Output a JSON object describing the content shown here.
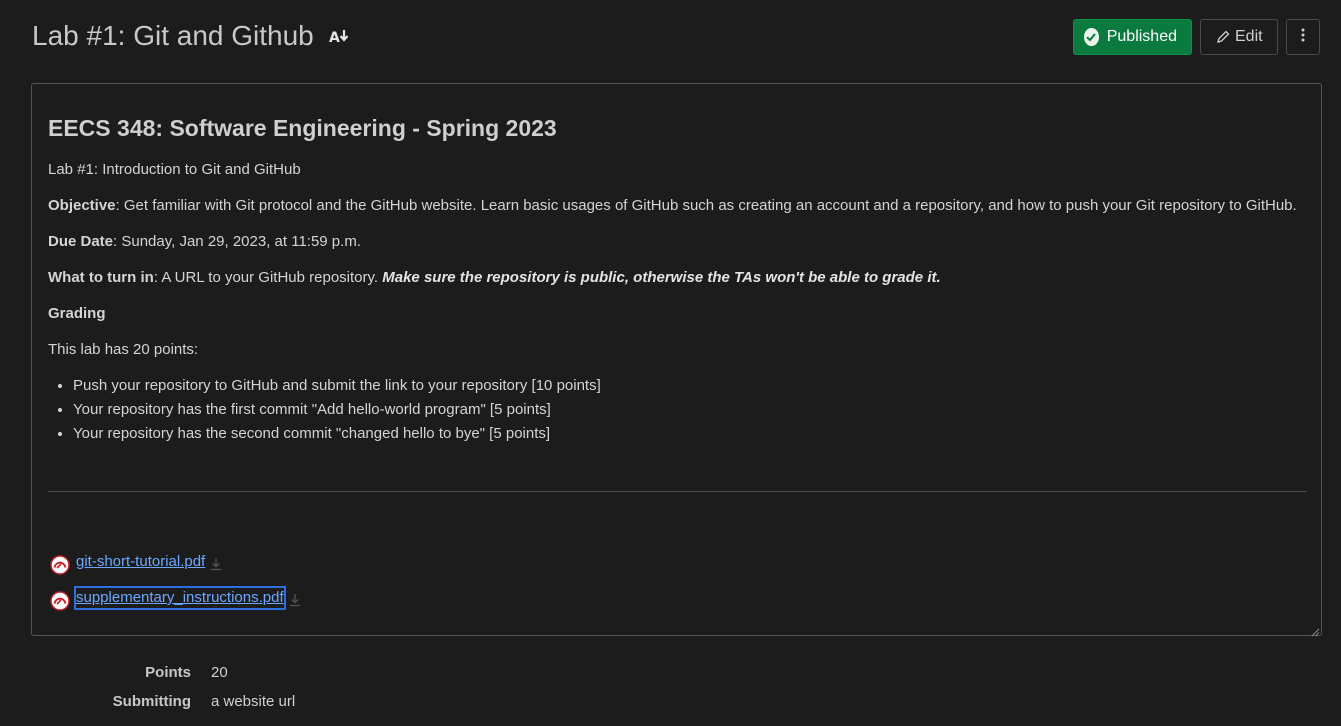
{
  "header": {
    "title": "Lab #1: Git and Github",
    "title_icon": "sort-download-icon",
    "published_label": "Published",
    "edit_label": "Edit",
    "more_icon": "kebab-menu-icon"
  },
  "content": {
    "heading": "EECS 348: Software Engineering - Spring 2023",
    "subtitle": "Lab #1: Introduction to Git and GitHub",
    "objective_label": "Objective",
    "objective_text": ": Get familiar with Git protocol and the GitHub website. Learn basic usages of GitHub such as creating an account and a repository, and how to push your Git repository to GitHub.",
    "due_label": "Due Date",
    "due_text": ": Sunday, Jan 29, 2023, at 11:59 p.m.",
    "turnin_label": "What to turn in",
    "turnin_text": ": A URL to your GitHub repository. ",
    "turnin_emphasis": "Make sure the repository is public, otherwise the TAs won't be able to grade it.",
    "grading_label": "Grading",
    "points_intro": "This lab has 20 points:",
    "bullets": [
      "Push your repository to GitHub and submit the link to your repository [10 points]",
      "Your repository has the first commit \"Add hello-world program\" [5 points]",
      "Your repository has the second commit \"changed hello to bye\" [5 points]"
    ],
    "files": [
      {
        "name": "git-short-tutorial.pdf",
        "icon": "pdf-file-icon"
      },
      {
        "name": "supplementary_instructions.pdf",
        "icon": "pdf-file-icon"
      }
    ]
  },
  "details": {
    "points_label": "Points",
    "points_value": "20",
    "submitting_label": "Submitting",
    "submitting_value": "a website url"
  },
  "colors": {
    "background": "#1c1c1d",
    "published_green": "#0b7a3e",
    "link_blue": "#6ba8ff"
  }
}
